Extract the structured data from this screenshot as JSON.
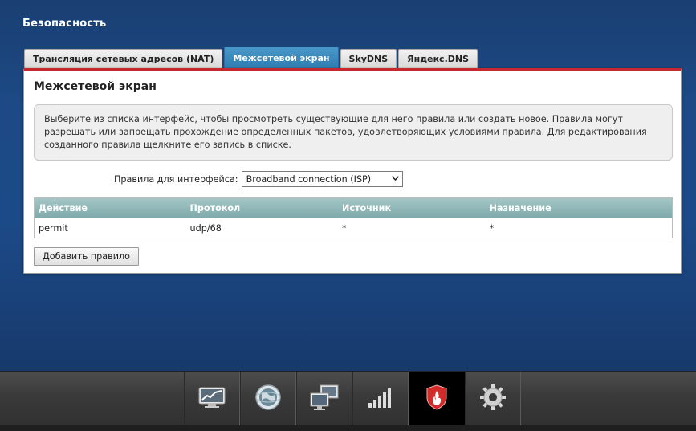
{
  "page": {
    "title": "Безопасность"
  },
  "tabs": [
    {
      "label": "Трансляция сетевых адресов (NAT)",
      "active": false
    },
    {
      "label": "Межсетевой экран",
      "active": true
    },
    {
      "label": "SkyDNS",
      "active": false
    },
    {
      "label": "Яндекс.DNS",
      "active": false
    }
  ],
  "panel": {
    "title": "Межсетевой экран",
    "info": "Выберите из списка интерфейс, чтобы просмотреть существующие для него правила или создать новое. Правила могут разрешать или запрещать прохождение определенных пакетов, удовлетворяющих условиями правила. Для редактирования созданного правила щелкните его запись в списке.",
    "interface_label": "Правила для интерфейса:",
    "interface_value": "Broadband connection (ISP)",
    "table": {
      "headers": [
        "Действие",
        "Протокол",
        "Источник",
        "Назначение"
      ],
      "rows": [
        [
          "permit",
          "udp/68",
          "*",
          "*"
        ]
      ]
    },
    "add_button": "Добавить правило"
  },
  "bottom_nav": [
    {
      "icon": "monitor-chart-icon",
      "active": false
    },
    {
      "icon": "globe-icon",
      "active": false
    },
    {
      "icon": "network-computers-icon",
      "active": false
    },
    {
      "icon": "wifi-signal-icon",
      "active": false
    },
    {
      "icon": "shield-fire-icon",
      "active": true
    },
    {
      "icon": "gear-icon",
      "active": false
    }
  ],
  "colors": {
    "accent_red": "#c6282f",
    "tab_active": "#2e7db3",
    "table_header": "#8fb5b6",
    "background": "#1d4a86"
  }
}
